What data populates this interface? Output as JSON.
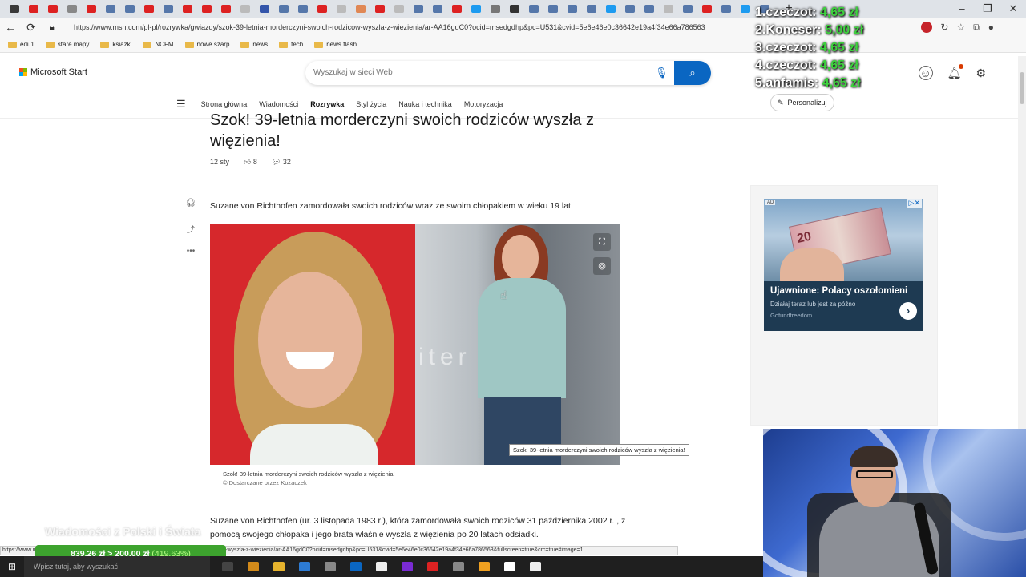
{
  "browser": {
    "tab_icon_colors": [
      "#3a3a3a",
      "#d22",
      "#d22",
      "#888",
      "#d22",
      "#5577aa",
      "#5577aa",
      "#d22",
      "#5577aa",
      "#d22",
      "#d22",
      "#d22",
      "#bbb",
      "#3355aa",
      "#5577aa",
      "#5577aa",
      "#d22",
      "#bbb",
      "#e08855",
      "#d22",
      "#bbb",
      "#5577aa",
      "#5577aa",
      "#d22",
      "#1d9bf0",
      "#777",
      "#333",
      "#5577aa",
      "#5577aa",
      "#5577aa",
      "#5577aa",
      "#1d9bf0",
      "#5577aa",
      "#5577aa",
      "#bbb",
      "#5577aa",
      "#d22",
      "#5577aa",
      "#1d9bf0",
      "#5577aa"
    ],
    "url": "https://www.msn.com/pl-pl/rozrywka/gwiazdy/szok-39-letnia-morderczyni-swoich-rodzicow-wyszla-z-wiezienia/ar-AA16gdC0?ocid=msedgdhp&pc=U531&cvid=5e6e46e0c36642e19a4f34e66a786563",
    "bookmarks": [
      "edu1",
      "stare mapy",
      "ksiazki",
      "NCFM",
      "nowe szarp",
      "news",
      "tech",
      "news flash"
    ]
  },
  "msn": {
    "logo": "Microsoft Start",
    "search_placeholder": "Wyszukaj w sieci Web",
    "nav": [
      "Strona główna",
      "Wiadomości",
      "Rozrywka",
      "Styl życia",
      "Nauka i technika",
      "Motoryzacja"
    ],
    "active_nav": "Rozrywka",
    "personalize": "Personalizuj"
  },
  "article": {
    "title": "Szok! 39-letnia morderczyni swoich rodziców wyszła z więzienia!",
    "date": "12 sty",
    "likes": "8",
    "comments": "32",
    "lead": "Suzane von Richthofen zamordowała swoich rodziców wraz ze swoim chłopakiem w wieku 19 lat.",
    "photo_wall_text": "iter",
    "tooltip": "Szok! 39-letnia morderczyni swoich rodziców wyszła z więzienia!",
    "caption": "Szok! 39-letnia morderczyni swoich rodziców wyszła z więzienia!",
    "caption_source": "© Dostarczane przez Kozaczek",
    "body": "Suzane von Richthofen (ur. 3 listopada 1983 r.), która zamordowała swoich rodziców 31 października 2002 r. , z pomocą swojego chłopaka i jego brata właśnie wyszła z więzienia po 20 latach odsiadki."
  },
  "ad": {
    "badge": "AD",
    "banknote": "20",
    "title": "Ujawnione: Polacy oszołomieni",
    "subtitle": "Działaj teraz lub jest za późno",
    "source": "Gofundfreedom"
  },
  "stream": {
    "ranking": [
      {
        "label": "1.czeczot: ",
        "amount": "4,65 zł"
      },
      {
        "label": "2.Koneser: ",
        "amount": "5,00 zł"
      },
      {
        "label": "3.czeczot: ",
        "amount": "4,65 zł"
      },
      {
        "label": "4.czeczot: ",
        "amount": "4,65 zł"
      },
      {
        "label": "5.anfamis: ",
        "amount": "4,65 zł"
      }
    ],
    "watermark": "Wiadomości z Polski i Świata",
    "donation": "839,26 zł > 200,00 zł",
    "donation_pct": "(419.63%)"
  },
  "status_url": "https://www.msn.com/pl-pl/rozrywka/gwiazdy/szok-39-letnia-morderczyni-swoich-rodzicow-wyszla-z-wiezienia/ar-AA16gdC0?ocid=msedgdhp&pc=U531&cvid=5e6e46e0c36642e19a4f34e66a786563&fullscreen=true&crc=true#image=1",
  "taskbar": {
    "search": "Wpisz tutaj, aby wyszukać",
    "icon_colors": [
      "#444",
      "#d28a1a",
      "#e6b32d",
      "#2d7bd3",
      "#888",
      "#0a66c2",
      "#eee",
      "#7a2bd3",
      "#d22",
      "#888",
      "#f0a020",
      "#fff",
      "#eee"
    ]
  }
}
